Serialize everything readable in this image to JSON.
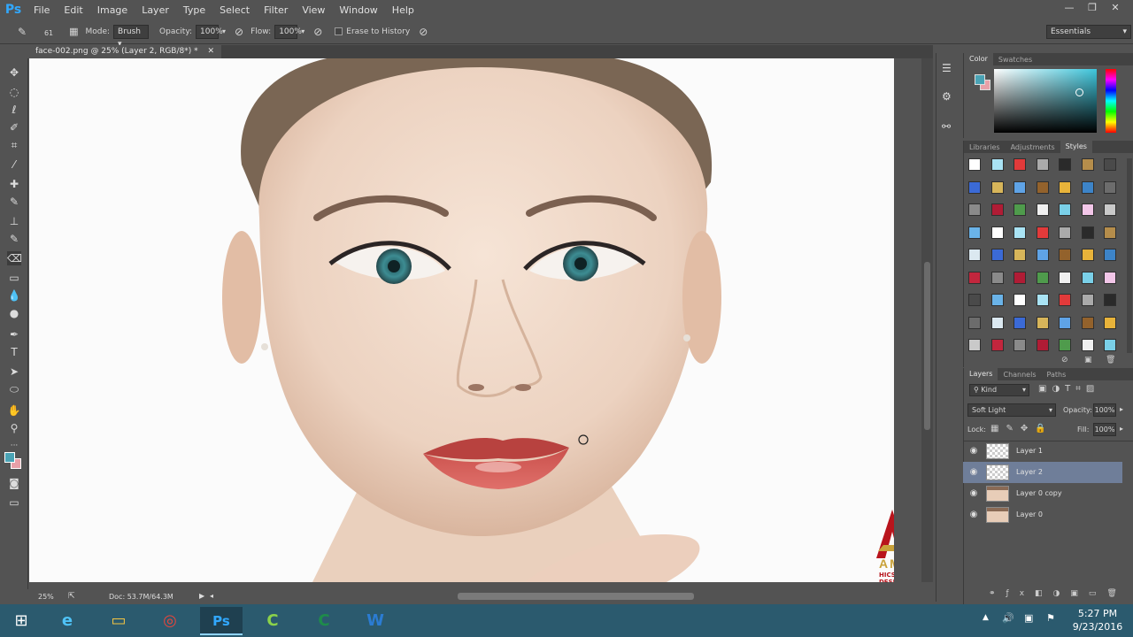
{
  "app": {
    "logo": "Ps",
    "menu": [
      "File",
      "Edit",
      "Image",
      "Layer",
      "Type",
      "Select",
      "Filter",
      "View",
      "Window",
      "Help"
    ],
    "window_controls": [
      "—",
      "❐",
      "✕"
    ]
  },
  "options": {
    "brush_size": "61",
    "mode_label": "Mode:",
    "mode_value": "Brush",
    "opacity_label": "Opacity:",
    "opacity_value": "100%",
    "flow_label": "Flow:",
    "flow_value": "100%",
    "erase_to_history": "Erase to History",
    "workspace": "Essentials"
  },
  "document": {
    "tab_title": "face-002.png @ 25% (Layer 2, RGB/8*) *",
    "zoom": "25%",
    "doc_size": "Doc: 53.7M/64.3M",
    "watermark_line1": "AMJAD",
    "watermark_line2": "HICS DESIGNER"
  },
  "color_panel": {
    "tabs": [
      "Color",
      "Swatches"
    ],
    "foreground": "#4aa3b5",
    "background": "#e8a0a8"
  },
  "styles_panel": {
    "tabs": [
      "Libraries",
      "Adjustments",
      "Styles"
    ]
  },
  "layers_panel": {
    "tabs": [
      "Layers",
      "Channels",
      "Paths"
    ],
    "filter_kind": "Kind",
    "blend_mode": "Soft Light",
    "opacity_label": "Opacity:",
    "opacity_value": "100%",
    "lock_label": "Lock:",
    "fill_label": "Fill:",
    "fill_value": "100%",
    "layers": [
      {
        "name": "Layer 1",
        "selected": false,
        "thumb": "transparent"
      },
      {
        "name": "Layer 2",
        "selected": true,
        "thumb": "transparent"
      },
      {
        "name": "Layer 0 copy",
        "selected": false,
        "thumb": "face"
      },
      {
        "name": "Layer 0",
        "selected": false,
        "thumb": "face"
      }
    ]
  },
  "taskbar": {
    "time": "5:27 PM",
    "date": "9/23/2016"
  },
  "colors": {
    "ui_bg": "#535353",
    "selected_layer": "#6f7e99",
    "taskbar": "#2b5a6e",
    "accent": "#31a8ff"
  }
}
